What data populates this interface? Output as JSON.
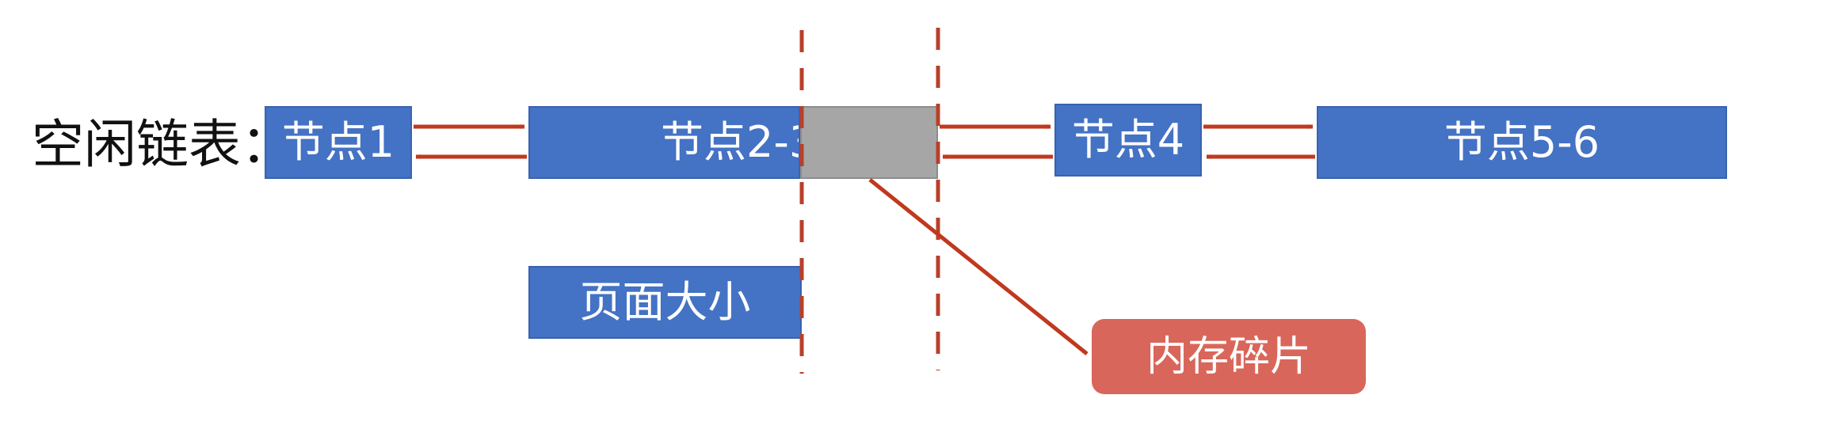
{
  "diagram": {
    "list_label": "空闲链表：",
    "nodes": [
      {
        "id": "n1",
        "label": "节点1"
      },
      {
        "id": "n23",
        "label": "节点2-3"
      },
      {
        "id": "n4",
        "label": "节点4"
      },
      {
        "id": "n56",
        "label": "节点5-6"
      }
    ],
    "page_size_label": "页面大小",
    "fragment_label": "内存碎片",
    "colors": {
      "node": "#4472c4",
      "fragment": "#a6a6a6",
      "callout": "#d9665a",
      "arrow": "#c0391e",
      "divider": "#b8402a"
    }
  }
}
